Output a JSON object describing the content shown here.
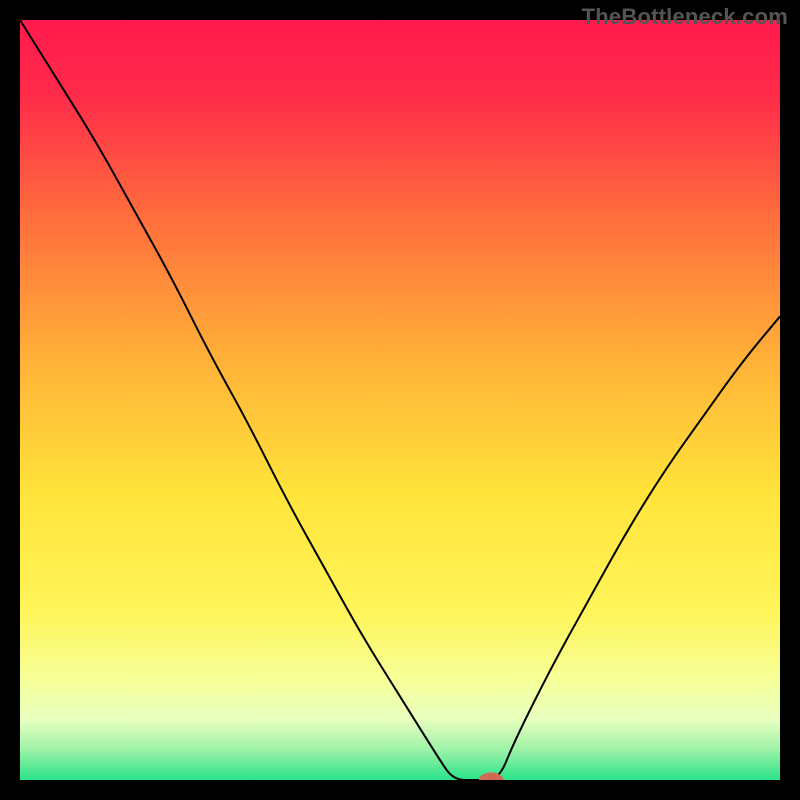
{
  "watermark": "TheBottleneck.com",
  "accent_color": "#cf6a55",
  "chart_data": {
    "type": "line",
    "title": "",
    "xlabel": "",
    "ylabel": "",
    "gradient_stops": [
      {
        "offset": 0.0,
        "color": "#ff1a4d"
      },
      {
        "offset": 0.1,
        "color": "#ff2b4a"
      },
      {
        "offset": 0.25,
        "color": "#ff6a3d"
      },
      {
        "offset": 0.45,
        "color": "#ffb238"
      },
      {
        "offset": 0.62,
        "color": "#ffe33a"
      },
      {
        "offset": 0.78,
        "color": "#fff55a"
      },
      {
        "offset": 0.87,
        "color": "#f6ff9a"
      },
      {
        "offset": 0.92,
        "color": "#e8ffbe"
      },
      {
        "offset": 0.96,
        "color": "#9df2a8"
      },
      {
        "offset": 1.0,
        "color": "#29e38a"
      }
    ],
    "x_range": [
      0,
      100
    ],
    "y_range": [
      0,
      100
    ],
    "series": [
      {
        "name": "bottleneck-curve",
        "x": [
          0,
          5,
          10,
          15,
          20,
          25,
          30,
          35,
          40,
          45,
          50,
          55,
          57,
          60,
          63,
          65,
          70,
          75,
          80,
          85,
          90,
          95,
          100
        ],
        "y": [
          100,
          92,
          84,
          75,
          66,
          56,
          47,
          37,
          28,
          19,
          11,
          3,
          0,
          0,
          0,
          5,
          15,
          24,
          33,
          41,
          48,
          55,
          61
        ]
      }
    ],
    "marker": {
      "x": 62,
      "y": 0,
      "rx": 1.6,
      "ry": 1.0
    }
  }
}
